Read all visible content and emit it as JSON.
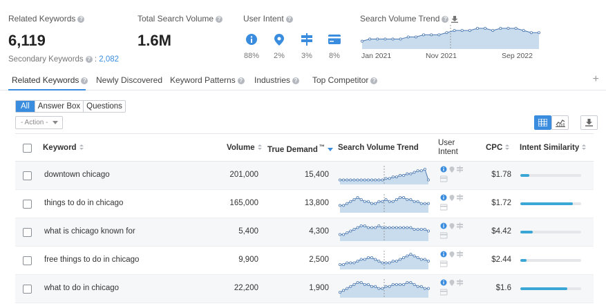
{
  "summary": {
    "related_keywords_label": "Related Keywords",
    "related_keywords_value": "6,119",
    "secondary_label": "Secondary Keywords",
    "secondary_value": "2,082",
    "total_volume_label": "Total Search Volume",
    "total_volume_value": "1.6M",
    "user_intent_label": "User Intent",
    "intents": [
      {
        "icon": "info-icon",
        "pct": "88%"
      },
      {
        "icon": "location-pin-icon",
        "pct": "2%"
      },
      {
        "icon": "signpost-icon",
        "pct": "3%"
      },
      {
        "icon": "credit-card-icon",
        "pct": "8%"
      }
    ],
    "trend_label": "Search Volume Trend",
    "trend_axis": [
      "Jan 2021",
      "Nov 2021",
      "Sep 2022"
    ],
    "trend_values": [
      3,
      4,
      4,
      4,
      4,
      4,
      5,
      5,
      6,
      6,
      6,
      7,
      8,
      8,
      8,
      9,
      9,
      8,
      9,
      9,
      9,
      8,
      7,
      7
    ]
  },
  "tabs": [
    {
      "label": "Related Keywords",
      "active": true
    },
    {
      "label": "Newly Discovered",
      "active": false
    },
    {
      "label": "Keyword Patterns",
      "active": false
    },
    {
      "label": "Industries",
      "active": false
    },
    {
      "label": "Top Competitor",
      "active": false
    }
  ],
  "filters": {
    "segments": [
      "All",
      "Answer Box",
      "Questions"
    ],
    "action_label": "- Action -"
  },
  "table": {
    "headers": {
      "keyword": "Keyword",
      "volume": "Volume",
      "true_demand": "True Demand",
      "tm": "™",
      "trend": "Search Volume Trend",
      "intent_1": "User",
      "intent_2": "Intent",
      "cpc": "CPC",
      "similarity": "Intent Similarity"
    },
    "rows": [
      {
        "keyword": "downtown chicago",
        "volume": "201,000",
        "true_demand": "15,400",
        "cpc": "$1.78",
        "similarity": 0.15,
        "trend": [
          2,
          2,
          2,
          2,
          2,
          2,
          2,
          2,
          2,
          2,
          2,
          2,
          2,
          3,
          3,
          4,
          4,
          5,
          5,
          6,
          6,
          7,
          8,
          8,
          9,
          2
        ]
      },
      {
        "keyword": "things to do in chicago",
        "volume": "165,000",
        "true_demand": "13,800",
        "cpc": "$1.72",
        "similarity": 0.86,
        "trend": [
          3,
          3,
          4,
          5,
          6,
          7,
          6,
          5,
          5,
          4,
          4,
          5,
          5,
          6,
          5,
          5,
          6,
          7,
          7,
          6,
          6,
          5,
          5,
          4,
          4,
          4
        ]
      },
      {
        "keyword": "what is chicago known for",
        "volume": "5,400",
        "true_demand": "4,300",
        "cpc": "$4.42",
        "similarity": 0.2,
        "trend": [
          3,
          3,
          4,
          5,
          6,
          7,
          8,
          8,
          7,
          7,
          7,
          8,
          7,
          7,
          7,
          7,
          7,
          7,
          7,
          7,
          7,
          6,
          6,
          6,
          6,
          5
        ]
      },
      {
        "keyword": "free things to do in chicago",
        "volume": "9,900",
        "true_demand": "2,500",
        "cpc": "$2.44",
        "similarity": 0.1,
        "trend": [
          2,
          2,
          3,
          3,
          3,
          4,
          5,
          5,
          6,
          6,
          5,
          4,
          3,
          3,
          3,
          4,
          4,
          5,
          6,
          7,
          8,
          7,
          6,
          5,
          5,
          4
        ]
      },
      {
        "keyword": "what to do in chicago",
        "volume": "22,200",
        "true_demand": "1,900",
        "cpc": "$1.6",
        "similarity": 0.77,
        "trend": [
          2,
          3,
          4,
          5,
          6,
          7,
          7,
          6,
          6,
          5,
          5,
          4,
          4,
          5,
          5,
          6,
          6,
          6,
          6,
          7,
          7,
          6,
          5,
          5,
          4,
          4
        ]
      }
    ]
  }
}
